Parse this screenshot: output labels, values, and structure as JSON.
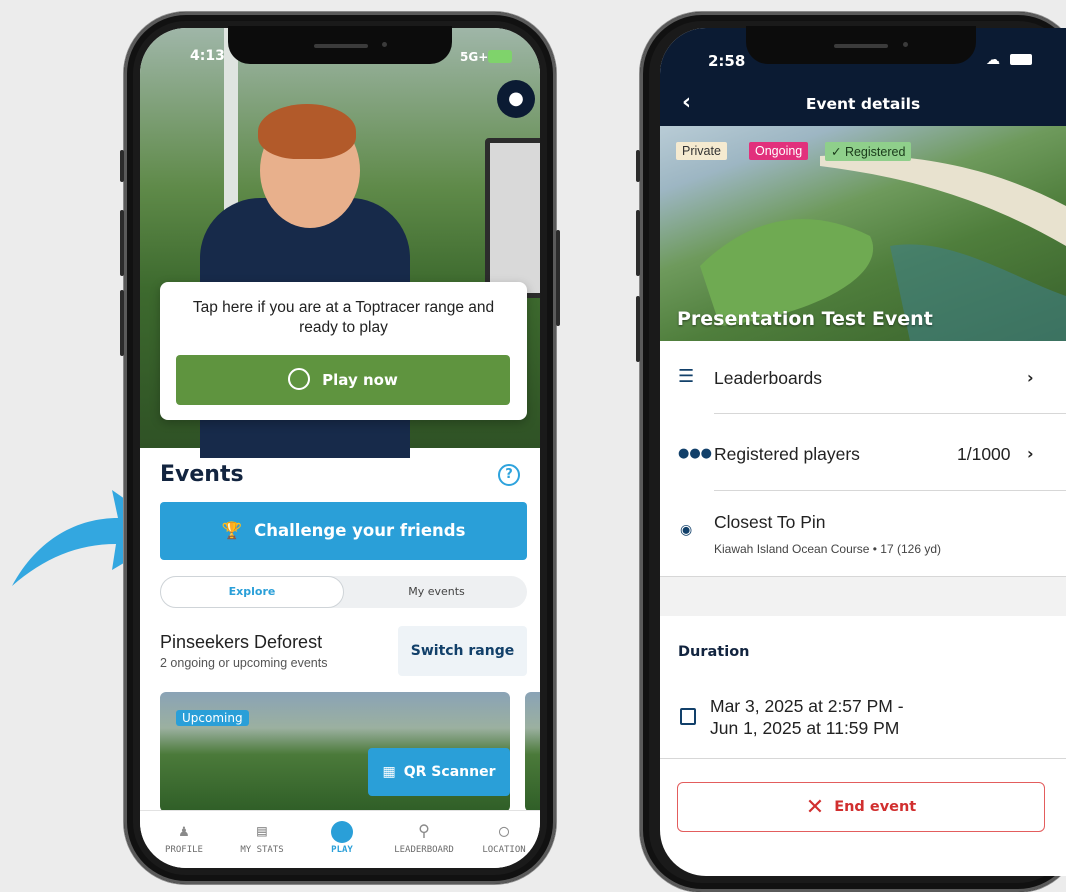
{
  "left_phone": {
    "status_time": "4:13",
    "status_network": "5G+",
    "tap_card": {
      "text": "Tap here if you are at a Toptracer range and ready to play",
      "play_button": "Play now"
    },
    "events": {
      "title": "Events",
      "challenge_button": "Challenge your friends",
      "tabs": [
        "Explore",
        "My events"
      ],
      "range_name": "Pinseekers Deforest",
      "range_subtitle": "2 ongoing or upcoming events",
      "switch_range_button": "Switch range",
      "card_tag": "Upcoming",
      "qr_button": "QR Scanner"
    },
    "tab_bar": [
      {
        "label": "PROFILE",
        "icon": "profile-icon"
      },
      {
        "label": "MY STATS",
        "icon": "stats-icon"
      },
      {
        "label": "PLAY",
        "icon": "play-icon",
        "active": true
      },
      {
        "label": "LEADERBOARD",
        "icon": "trophy-icon"
      },
      {
        "label": "LOCATION",
        "icon": "location-pin-icon"
      }
    ]
  },
  "right_phone": {
    "status_time": "2:58",
    "header_title": "Event details",
    "tags": {
      "private": "Private",
      "ongoing": "Ongoing",
      "registered": "✓ Registered"
    },
    "event_name": "Presentation Test Event",
    "rows": {
      "leaderboards": "Leaderboards",
      "registered_players": "Registered players",
      "registered_count": "1/1000",
      "game_mode": "Closest To Pin",
      "course_info": "Kiawah Island Ocean Course • 17 (126 yd)"
    },
    "duration": {
      "title": "Duration",
      "start": "Mar 3, 2025 at 2:57 PM -",
      "end": "Jun 1, 2025 at 11:59 PM"
    },
    "end_button": "End event"
  },
  "colors": {
    "accent_blue": "#2a9fd8",
    "play_green": "#5f943f",
    "header_navy": "#0b1b33",
    "ongoing_pink": "#e2307c",
    "registered_green": "#8fcf8b",
    "end_red": "#d12f2f"
  }
}
